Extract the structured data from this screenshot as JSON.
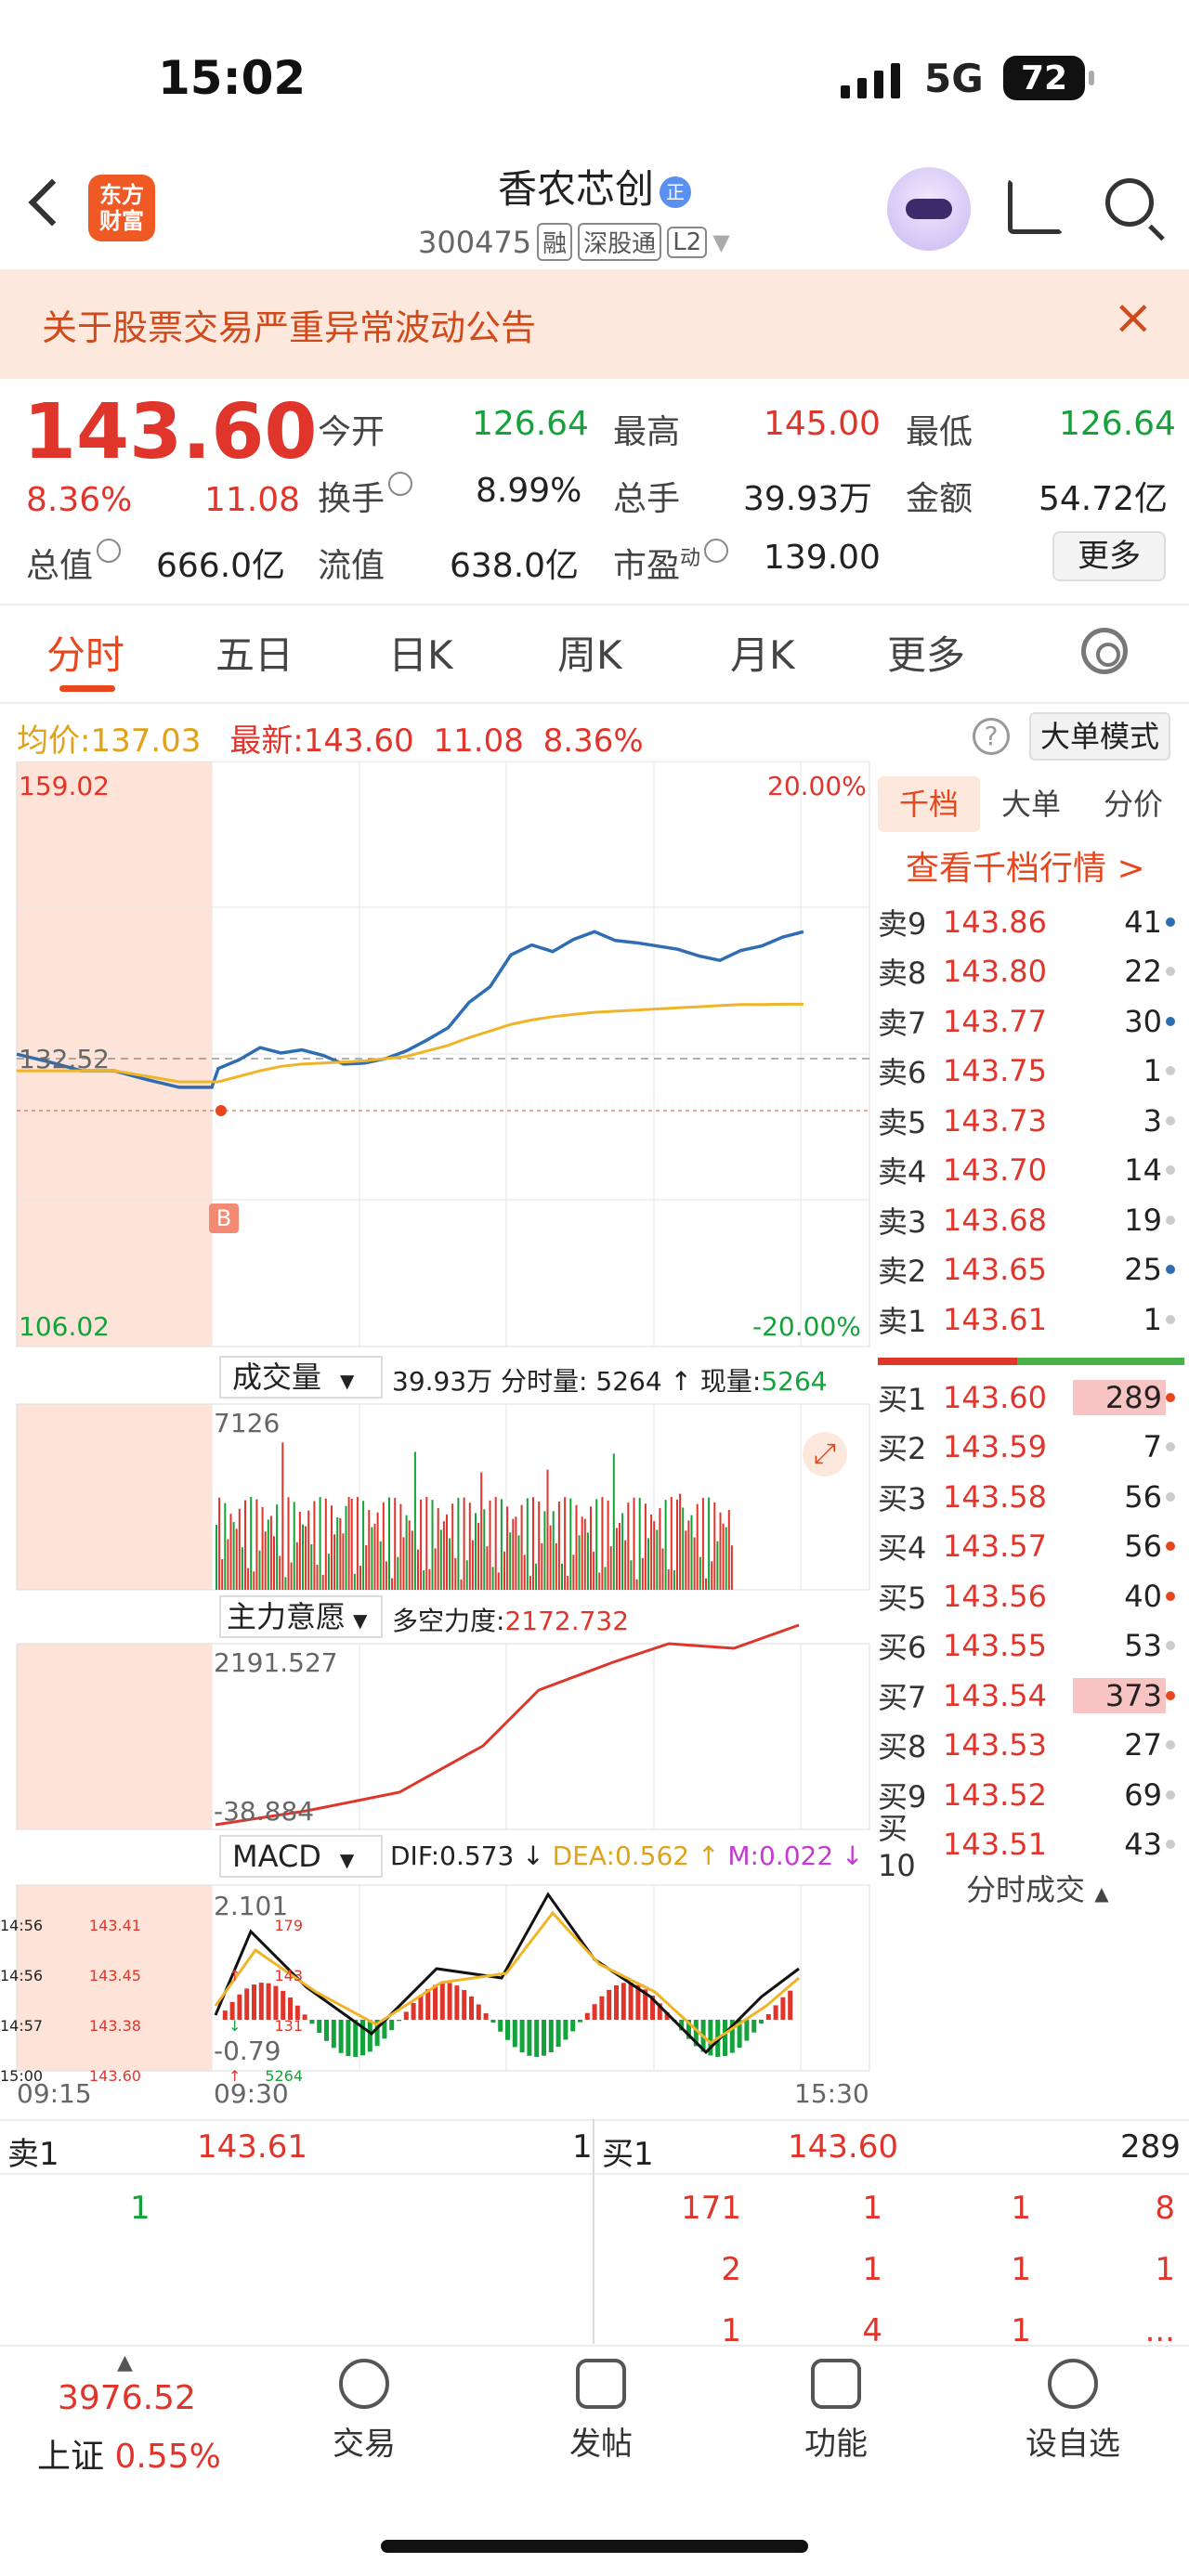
{
  "status": {
    "time": "15:02",
    "network": "5G",
    "battery": "72"
  },
  "header": {
    "logo": "东方\n财富",
    "name": "香农芯创",
    "name_badge": "正",
    "code": "300475",
    "tags": [
      "融",
      "深股通",
      "L2"
    ]
  },
  "notice": {
    "text": "关于股票交易严重异常波动公告",
    "close": "×"
  },
  "quote": {
    "price": "143.60",
    "pct": "8.36%",
    "change": "11.08",
    "open_label": "今开",
    "open": "126.64",
    "high_label": "最高",
    "high": "145.00",
    "low_label": "最低",
    "low": "126.64",
    "turnover_label": "换手",
    "turnover": "8.99%",
    "vol_label": "总手",
    "vol": "39.93万",
    "amount_label": "金额",
    "amount": "54.72亿",
    "mcap_label": "总值",
    "mcap": "666.0亿",
    "float_label": "流值",
    "float": "638.0亿",
    "pe_label": "市盈",
    "pe_sup": "动",
    "pe": "139.00",
    "more": "更多"
  },
  "tabs": [
    "分时",
    "五日",
    "日K",
    "周K",
    "月K",
    "更多"
  ],
  "legend": {
    "avg_label": "均价:",
    "avg": "137.03",
    "latest_label": "最新:",
    "latest": "143.60",
    "chg": "11.08",
    "pct": "8.36%",
    "help": "?",
    "bigmode": "大单模式"
  },
  "chart": {
    "ymax": "159.02",
    "ymin": "106.02",
    "ref": "132.52",
    "pmax": "20.00%",
    "pmin": "-20.00%",
    "b_marker": "B",
    "vol_selector": "成交量",
    "vol_info": "39.93万 分时量: 5264 ↑ 现量:",
    "vol_now": "5264",
    "vol_max": "7126",
    "main_selector": "主力意愿",
    "main_info_label": "多空力度:",
    "main_info": "2172.732",
    "main_max": "2191.527",
    "main_min": "-38.884",
    "macd_selector": "MACD",
    "dif": "DIF:0.573 ↓",
    "dea": "DEA:0.562 ↑",
    "m": "M:0.022 ↓",
    "macd_max": "2.101",
    "macd_min": "-0.79",
    "times": [
      "09:15",
      "09:30",
      "15:30"
    ]
  },
  "chart_data": {
    "type": "line",
    "title": "",
    "series": [
      {
        "name": "最新",
        "values": [
          132.5,
          131.8,
          131.0,
          131.0,
          130.2,
          129.5,
          129.5,
          131.2,
          132.0,
          133.1,
          132.6,
          132.9,
          132.4,
          131.6,
          131.7,
          132.1,
          132.8,
          133.8,
          134.9,
          137.2,
          138.6,
          141.5,
          142.4,
          141.8,
          142.9,
          143.6,
          142.8,
          142.6,
          142.3,
          142.0,
          141.4,
          141.0,
          141.9,
          142.3,
          143.1,
          143.6
        ]
      },
      {
        "name": "均价",
        "values": [
          131.0,
          131.0,
          131.0,
          131.0,
          130.5,
          130.0,
          130.0,
          130.0,
          130.5,
          131.0,
          131.4,
          131.6,
          131.7,
          131.8,
          131.9,
          132.1,
          132.3,
          132.8,
          133.3,
          134.0,
          134.6,
          135.2,
          135.6,
          135.9,
          136.1,
          136.3,
          136.4,
          136.5,
          136.6,
          136.7,
          136.8,
          136.9,
          137.0,
          137.0,
          137.03,
          137.03
        ]
      }
    ],
    "ylim": [
      106.02,
      159.02
    ],
    "xlabel": "",
    "ylabel": ""
  },
  "depth": {
    "tabs": [
      "千档",
      "大单",
      "分价"
    ],
    "link": "查看千档行情 >",
    "asks": [
      [
        "卖9",
        "143.86",
        "41"
      ],
      [
        "卖8",
        "143.80",
        "22"
      ],
      [
        "卖7",
        "143.77",
        "30"
      ],
      [
        "卖6",
        "143.75",
        "1"
      ],
      [
        "卖5",
        "143.73",
        "3"
      ],
      [
        "卖4",
        "143.70",
        "14"
      ],
      [
        "卖3",
        "143.68",
        "19"
      ],
      [
        "卖2",
        "143.65",
        "25"
      ],
      [
        "卖1",
        "143.61",
        "1"
      ]
    ],
    "bids": [
      [
        "买1",
        "143.60",
        "289"
      ],
      [
        "买2",
        "143.59",
        "7"
      ],
      [
        "买3",
        "143.58",
        "56"
      ],
      [
        "买4",
        "143.57",
        "56"
      ],
      [
        "买5",
        "143.56",
        "40"
      ],
      [
        "买6",
        "143.55",
        "53"
      ],
      [
        "买7",
        "143.54",
        "373"
      ],
      [
        "买8",
        "143.53",
        "27"
      ],
      [
        "买9",
        "143.52",
        "69"
      ],
      [
        "买10",
        "143.51",
        "43"
      ]
    ],
    "ticks_title": "分时成交",
    "ticks": [
      [
        "14:56",
        "143.41",
        "",
        "179"
      ],
      [
        "14:56",
        "143.45",
        "↑",
        "143"
      ],
      [
        "14:57",
        "143.38",
        "↓",
        "131"
      ],
      [
        "15:00",
        "143.60",
        "↑",
        "5264"
      ]
    ]
  },
  "lower": {
    "sell_label": "卖1",
    "sell_price": "143.61",
    "sell_qty": "1",
    "buy_label": "买1",
    "buy_price": "143.60",
    "buy_qty": "289",
    "left": [
      "1"
    ],
    "right": [
      [
        "171",
        "1",
        "1",
        "8"
      ],
      [
        "2",
        "1",
        "1",
        "1"
      ],
      [
        "1",
        "4",
        "1",
        "..."
      ]
    ]
  },
  "bottom": {
    "index_value": "3976.52",
    "index_name": "上证",
    "index_pct": "0.55%",
    "items": [
      "交易",
      "发帖",
      "功能",
      "设自选"
    ]
  }
}
